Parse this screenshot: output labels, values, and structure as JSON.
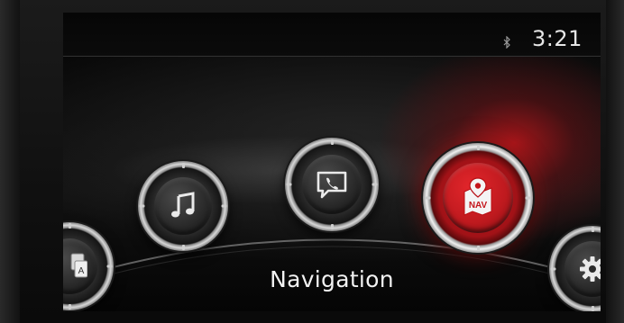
{
  "status_bar": {
    "time": "3:21",
    "bluetooth_icon": "bluetooth-icon"
  },
  "menu": {
    "items": [
      {
        "id": "apps",
        "icon": "apps-icon",
        "label": "A",
        "active": false
      },
      {
        "id": "music",
        "icon": "music-note-icon",
        "active": false
      },
      {
        "id": "communication",
        "icon": "phone-message-icon",
        "active": false
      },
      {
        "id": "navigation",
        "icon": "nav-map-pin-icon",
        "badge": "NAV",
        "active": true
      },
      {
        "id": "settings",
        "icon": "gear-icon",
        "active": false
      }
    ],
    "selected_label": "Navigation"
  },
  "colors": {
    "accent": "#c4161c",
    "text": "#f2f2f2",
    "background": "#0b0b0b"
  }
}
